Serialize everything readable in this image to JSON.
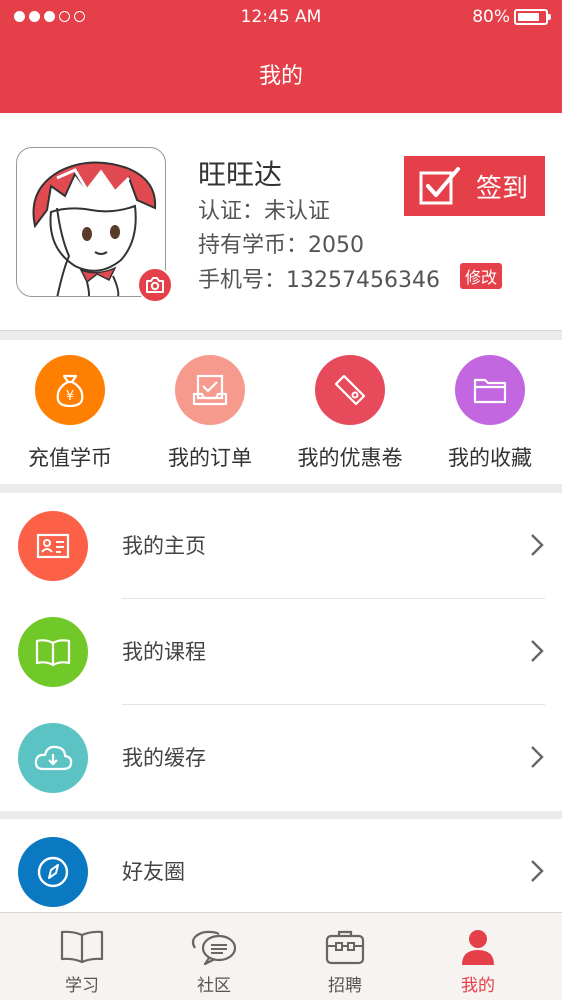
{
  "status_bar": {
    "time": "12:45 AM",
    "battery": "80%",
    "battery_level": 0.8,
    "signal_bars": 3
  },
  "header": {
    "title": "我的"
  },
  "profile": {
    "name": "旺旺达",
    "certification": "认证：未认证",
    "coins": "持有学币：2050",
    "phone": "手机号：13257456346",
    "edit_label": "修改",
    "signin_label": "签到"
  },
  "quick_actions": [
    {
      "label": "充值学币",
      "icon": "money-bag-icon",
      "color": "#ff7f00"
    },
    {
      "label": "我的订单",
      "icon": "order-box-icon",
      "color": "#f59a8c"
    },
    {
      "label": "我的优惠卷",
      "icon": "coupon-tag-icon",
      "color": "#e74b5b"
    },
    {
      "label": "我的收藏",
      "icon": "folder-icon",
      "color": "#c267e0"
    }
  ],
  "menu": [
    {
      "label": "我的主页",
      "icon": "profile-card-icon",
      "color": "#fc6148"
    },
    {
      "label": "我的课程",
      "icon": "open-book-icon",
      "color": "#71c829"
    },
    {
      "label": "我的缓存",
      "icon": "cloud-download-icon",
      "color": "#5cc3c4"
    },
    {
      "label": "好友圈",
      "icon": "compass-icon",
      "color": "#0b79c2"
    }
  ],
  "tabs": [
    {
      "label": "学习",
      "icon": "book-icon"
    },
    {
      "label": "社区",
      "icon": "chat-bubbles-icon"
    },
    {
      "label": "招聘",
      "icon": "briefcase-icon"
    },
    {
      "label": "我的",
      "icon": "person-icon"
    }
  ],
  "colors": {
    "brand": "#e5404a",
    "background": "#ebebeb"
  }
}
